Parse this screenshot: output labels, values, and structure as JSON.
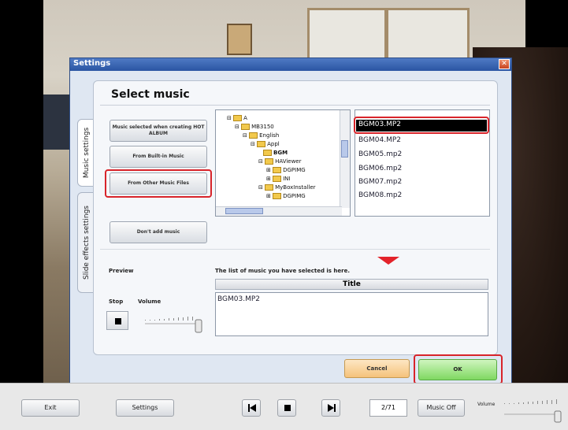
{
  "dialog": {
    "title": "Settings",
    "close_glyph": "✕",
    "panel_title": "Select music",
    "tabs": [
      {
        "label": "Music settings",
        "active": true
      },
      {
        "label": "Slide effects settings",
        "active": false
      }
    ],
    "source_buttons": [
      {
        "label": "Music selected when creating HOT ALBUM"
      },
      {
        "label": "From Built-in Music"
      },
      {
        "label": "From Other Music Files",
        "highlighted": true
      },
      {
        "label": "Don't add music"
      }
    ],
    "tree": {
      "nodes": [
        {
          "text": "A"
        },
        {
          "text": "MB3150"
        },
        {
          "text": "English"
        },
        {
          "text": "Appl"
        },
        {
          "text": "BGM"
        },
        {
          "text": "HAViewer"
        },
        {
          "text": "DGPIMG"
        },
        {
          "text": "INI"
        },
        {
          "text": "MyBoxInstaller"
        },
        {
          "text": "DGPIMG"
        }
      ]
    },
    "files": {
      "items": [
        "BGM03.MP2",
        "BGM04.MP2",
        "BGM05.mp2",
        "BGM06.mp2",
        "BGM07.mp2",
        "BGM08.mp2"
      ],
      "selected": "BGM03.MP2"
    },
    "preview": {
      "label": "Preview",
      "stop_label": "Stop",
      "volume_label": "Volume"
    },
    "selection": {
      "hint": "The list of music you have selected is here.",
      "column_title": "Title",
      "items": [
        "BGM03.MP2"
      ]
    },
    "cancel_label": "Cancel",
    "ok_label": "OK",
    "accent_red": "#d8242a"
  },
  "toolbar": {
    "exit_label": "Exit",
    "settings_label": "Settings",
    "counter": "2/71",
    "music_label": "Music Off",
    "volume_label": "Volume"
  }
}
